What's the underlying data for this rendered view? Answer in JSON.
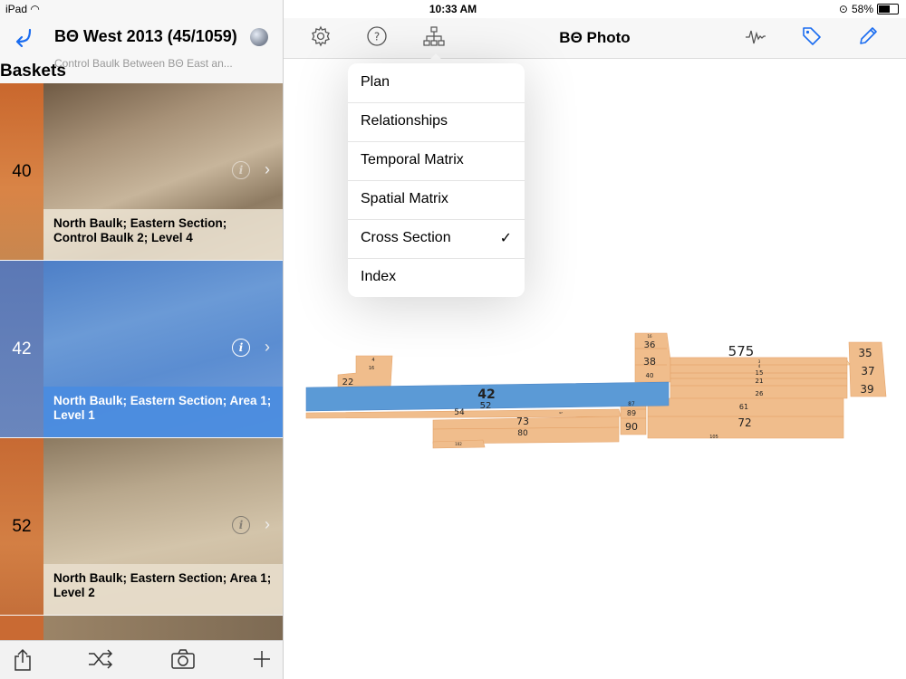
{
  "status": {
    "device": "iPad",
    "time": "10:33 AM",
    "battery": "58%",
    "battery_level": 0.58
  },
  "sidebar": {
    "title": "BΘ West 2013 (45/1059)",
    "breadcrumb": "Control Baulk Between BΘ East an...",
    "section": "Baskets",
    "rows": [
      {
        "number": "40",
        "caption": "North Baulk; Eastern Section; Control Baulk 2; Level 4"
      },
      {
        "number": "42",
        "caption": "North Baulk; Eastern Section; Area 1; Level 1"
      },
      {
        "number": "52",
        "caption": "North Baulk; Eastern Section; Area 1; Level 2"
      }
    ]
  },
  "main": {
    "title": "BΘ Photo"
  },
  "menu": {
    "items": [
      {
        "label": "Plan",
        "checked": false
      },
      {
        "label": "Relationships",
        "checked": false
      },
      {
        "label": "Temporal Matrix",
        "checked": false
      },
      {
        "label": "Spatial Matrix",
        "checked": false
      },
      {
        "label": "Cross Section",
        "checked": true
      },
      {
        "label": "Index",
        "checked": false
      }
    ],
    "check": "✓"
  },
  "section": {
    "labels": [
      "575",
      "35",
      "37",
      "39",
      "36",
      "38",
      "40",
      "16",
      "3",
      "4",
      "15",
      "21",
      "26",
      "22",
      "42",
      "52",
      "54",
      "73",
      "80",
      "87",
      "89",
      "90",
      "61",
      "72",
      "105",
      "102",
      "97",
      "4",
      "16"
    ]
  },
  "colors": {
    "accent": "#1a6cf0",
    "layer": "#f0bd8c",
    "selected": "#5b9ad6"
  }
}
